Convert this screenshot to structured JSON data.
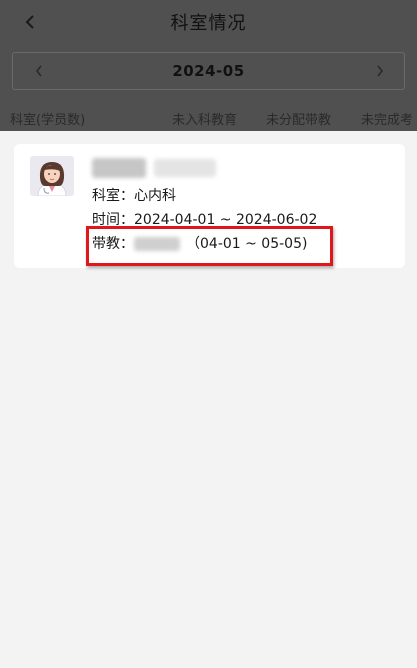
{
  "header": {
    "title": "科室情况",
    "back_icon": "chevron-left-icon"
  },
  "month_bar": {
    "label": "2024-05",
    "prev_icon": "chevron-left-icon",
    "next_icon": "chevron-right-icon"
  },
  "tabs": [
    {
      "label": "科室(学员数)"
    },
    {
      "label": "未入科教育"
    },
    {
      "label": "未分配带教"
    },
    {
      "label": "未完成考"
    }
  ],
  "card": {
    "avatar_icon": "doctor-avatar-icon",
    "dept_label": "科室：",
    "dept_value": "心内科",
    "time_label": "时间：",
    "time_value": "2024-04-01 ~ 2024-06-02",
    "teacher_label": "带教：",
    "teacher_range": "（04-01 ~ 05-05)"
  },
  "colors": {
    "overlay": "#505050",
    "background": "#f3f3f3",
    "card": "#ffffff",
    "highlight": "#e0161c"
  }
}
